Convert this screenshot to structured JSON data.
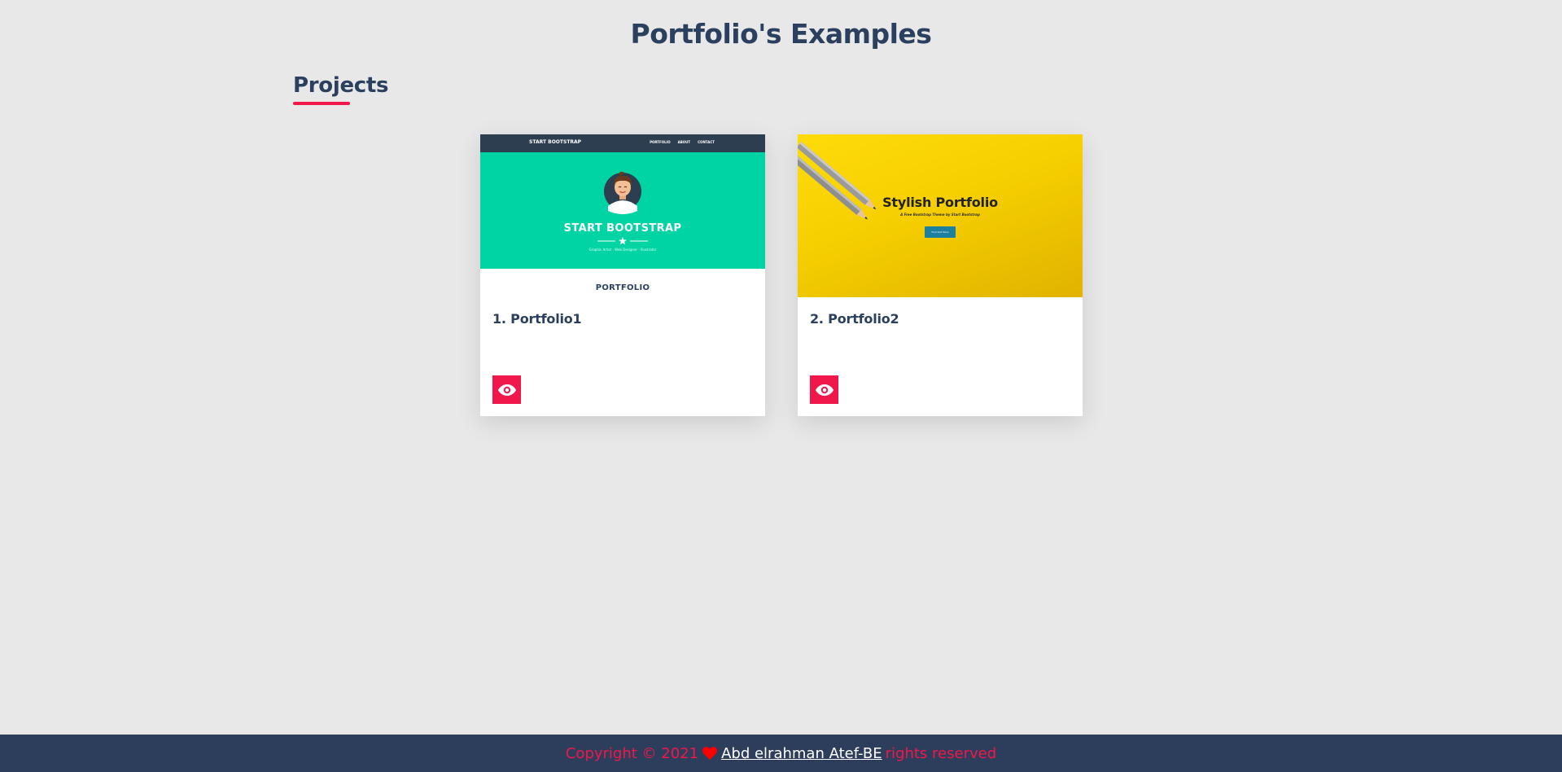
{
  "header": {
    "title": "Portfolio's Examples"
  },
  "section": {
    "title": "Projects"
  },
  "colors": {
    "accent": "#f0184a",
    "navy": "#2c3e5c",
    "background": "#e8e8e8"
  },
  "projects": [
    {
      "title": "1. Portfolio1",
      "view_icon": "eye-icon",
      "preview": {
        "brand": "START BOOTSTRAP",
        "nav_links": [
          "PORTFOLIO",
          "ABOUT",
          "CONTACT"
        ],
        "hero_title": "START BOOTSTRAP",
        "tagline": "Graphic Artist - Web Designer - Illustrator",
        "section_title": "PORTFOLIO",
        "hero_color": "#00d4a4"
      }
    },
    {
      "title": "2. Portfolio2",
      "view_icon": "eye-icon",
      "preview": {
        "hero_title": "Stylish Portfolio",
        "subtitle": "A Free Bootstrap Theme by Start Bootstrap",
        "button": "Find Out More",
        "hero_color": "#f6cf00"
      }
    }
  ],
  "footer": {
    "copyright": "Copyright © 2021",
    "heart_icon": "heart-icon",
    "author": "Abd elrahman Atef-BE",
    "rights": "rights reserved"
  }
}
